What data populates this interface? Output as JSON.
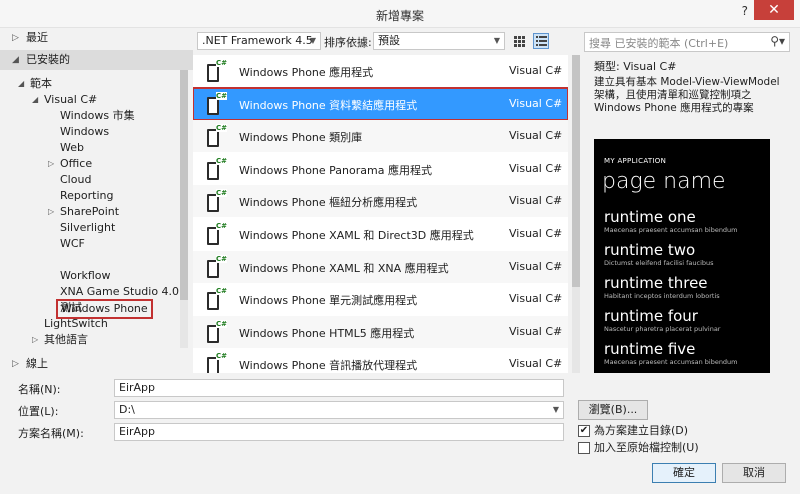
{
  "window": {
    "title": "新增專案",
    "help": "?",
    "close": "✕"
  },
  "left": {
    "recent": "最近",
    "installed": "已安裝的",
    "online": "線上",
    "tree": [
      {
        "label": "範本",
        "indent": 0,
        "arrow": "◢"
      },
      {
        "label": "Visual C#",
        "indent": 1,
        "arrow": "◢"
      },
      {
        "label": "Windows 市集",
        "indent": 2,
        "arrow": ""
      },
      {
        "label": "Windows",
        "indent": 2,
        "arrow": ""
      },
      {
        "label": "Web",
        "indent": 2,
        "arrow": ""
      },
      {
        "label": "Office",
        "indent": 2,
        "arrow": "▷"
      },
      {
        "label": "Cloud",
        "indent": 2,
        "arrow": ""
      },
      {
        "label": "Reporting",
        "indent": 2,
        "arrow": ""
      },
      {
        "label": "SharePoint",
        "indent": 2,
        "arrow": "▷"
      },
      {
        "label": "Silverlight",
        "indent": 2,
        "arrow": ""
      },
      {
        "label": "WCF",
        "indent": 2,
        "arrow": ""
      },
      {
        "label": "Windows Phone",
        "indent": 2,
        "arrow": "",
        "selected": true
      },
      {
        "label": "Workflow",
        "indent": 2,
        "arrow": ""
      },
      {
        "label": "XNA Game Studio 4.0",
        "indent": 2,
        "arrow": ""
      },
      {
        "label": "測試",
        "indent": 2,
        "arrow": ""
      },
      {
        "label": "LightSwitch",
        "indent": 1,
        "arrow": ""
      },
      {
        "label": "其他語言",
        "indent": 1,
        "arrow": "▷"
      }
    ]
  },
  "toolbar": {
    "framework": ".NET Framework 4.5",
    "sort_label": "排序依據:",
    "sort_value": "預設",
    "search_placeholder": "搜尋 已安裝的範本 (Ctrl+E)"
  },
  "templates": [
    {
      "name": "Windows Phone 應用程式",
      "lang": "Visual C#"
    },
    {
      "name": "Windows Phone 資料繫結應用程式",
      "lang": "Visual C#",
      "selected": true
    },
    {
      "name": "Windows Phone 類別庫",
      "lang": "Visual C#"
    },
    {
      "name": "Windows Phone Panorama 應用程式",
      "lang": "Visual C#"
    },
    {
      "name": "Windows Phone 樞紐分析應用程式",
      "lang": "Visual C#"
    },
    {
      "name": "Windows Phone XAML 和 Direct3D 應用程式",
      "lang": "Visual C#"
    },
    {
      "name": "Windows Phone XAML 和 XNA 應用程式",
      "lang": "Visual C#"
    },
    {
      "name": "Windows Phone 單元測試應用程式",
      "lang": "Visual C#"
    },
    {
      "name": "Windows Phone HTML5 應用程式",
      "lang": "Visual C#"
    },
    {
      "name": "Windows Phone 音訊播放代理程式",
      "lang": "Visual C#"
    }
  ],
  "description": {
    "type": "類型:  Visual C#",
    "text": "建立具有基本 Model-View-ViewModel 架構，且使用清單和巡覽控制項之 Windows Phone 應用程式的專案",
    "preview": {
      "app": "MY APPLICATION",
      "title": "page name",
      "items": [
        {
          "h": "runtime one",
          "s": "Maecenas praesent accumsan bibendum"
        },
        {
          "h": "runtime two",
          "s": "Dictumst eleifend facilisi faucibus"
        },
        {
          "h": "runtime three",
          "s": "Habitant inceptos interdum lobortis"
        },
        {
          "h": "runtime four",
          "s": "Nascetur pharetra placerat pulvinar"
        },
        {
          "h": "runtime five",
          "s": "Maecenas praesent accumsan bibendum"
        }
      ]
    }
  },
  "form": {
    "name_label": "名稱(N):",
    "name_value": "EirApp",
    "location_label": "位置(L):",
    "location_value": "D:\\",
    "solution_label": "方案名稱(M):",
    "solution_value": "EirApp",
    "browse": "瀏覽(B)...",
    "create_dir": "為方案建立目錄(D)",
    "create_dir_checked": true,
    "source_control": "加入至原始檔控制(U)",
    "source_control_checked": false,
    "ok": "確定",
    "cancel": "取消"
  }
}
